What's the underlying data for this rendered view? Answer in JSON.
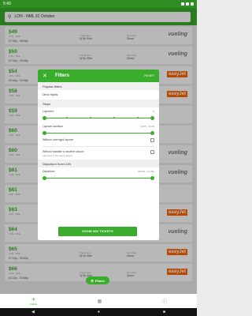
{
  "status": {
    "time": "5:49"
  },
  "search": {
    "route": "LON - NML 31 October"
  },
  "flights": [
    {
      "price": "$49",
      "route": "LON - NML",
      "times": "07:05p - 08:55p",
      "duration_label": "Travel time",
      "duration": "0(?)h 50m",
      "stops_label": "Non-stop",
      "stops": "Direct",
      "airline": "vueling"
    },
    {
      "price": "$50",
      "route": "LON - NML",
      "times": "07:20p - 09:45p",
      "duration_label": "Travel time",
      "duration": "0(?)h 25m",
      "stops_label": "Non-stop",
      "stops": "Direct",
      "airline": "vueling"
    },
    {
      "price": "$54",
      "route": "LON - NML",
      "times": "02:40p - 04:35p",
      "duration_label": "Travel time",
      "duration": "0(?)h 55m",
      "stops_label": "Non-stop",
      "stops": "Direct",
      "airline": "easyJet"
    },
    {
      "price": "$58",
      "route": "LON - NML",
      "times": "",
      "duration_label": "",
      "duration": "",
      "stops_label": "",
      "stops": "",
      "airline": "easyJet"
    },
    {
      "price": "$59",
      "route": "LON - NML",
      "times": "",
      "duration_label": "",
      "duration": "",
      "stops_label": "",
      "stops": "",
      "airline": ""
    },
    {
      "price": "$60",
      "route": "LON - NML",
      "times": "",
      "duration_label": "",
      "duration": "",
      "stops_label": "",
      "stops": "",
      "airline": ""
    },
    {
      "price": "$60",
      "route": "LON - NML",
      "times": "",
      "duration_label": "",
      "duration": "",
      "stops_label": "",
      "stops": "",
      "airline": "vueling"
    },
    {
      "price": "$61",
      "route": "LON - NML",
      "times": "",
      "duration_label": "",
      "duration": "",
      "stops_label": "",
      "stops": "",
      "airline": "vueling"
    },
    {
      "price": "$61",
      "route": "LON - NML",
      "times": "",
      "duration_label": "",
      "duration": "",
      "stops_label": "",
      "stops": "",
      "airline": ""
    },
    {
      "price": "$63",
      "route": "LON - NML",
      "times": "",
      "duration_label": "",
      "duration": "",
      "stops_label": "",
      "stops": "",
      "airline": "easyJet"
    },
    {
      "price": "$64",
      "route": "LON - NML",
      "times": "",
      "duration_label": "",
      "duration": "",
      "stops_label": "",
      "stops": "",
      "airline": "vueling"
    },
    {
      "price": "$65",
      "route": "LON - NML",
      "times": "07:15p - 09:00p",
      "duration_label": "Travel time",
      "duration": "0(?)h 45m",
      "stops_label": "Non-stop",
      "stops": "Direct",
      "airline": "easyJet"
    },
    {
      "price": "$66",
      "route": "LON - NML",
      "times": "03:15p - 04:55p",
      "duration_label": "Travel time",
      "duration": "0(?)h 40m",
      "stops_label": "Non-stop",
      "stops": "Direct",
      "airline": "easyJet"
    }
  ],
  "filters": {
    "title": "Filters",
    "reset": "RESET",
    "popular_section": "Popular filters",
    "direct_flights": "Direct flights",
    "stops_section": "Stops",
    "layovers": "Layovers",
    "layovers_value": "0",
    "layover_duration": "Layover duration",
    "layover_duration_value": "00:55 - 25:15",
    "without_overnight": "Without overnight layover",
    "without_transfer": "Without transfer to another airport",
    "without_transfer_sub": "Layovers in the same airport",
    "departure_section": "Departure from LON",
    "departure": "Departure",
    "departure_value": "05:00a - 11:45p",
    "show_button": "SHOW 683 TICKETS"
  },
  "fab": {
    "label": "Filters"
  },
  "nav": {
    "flights": "Flights",
    "icons": [
      "plane-icon",
      "bed-icon",
      "info-icon"
    ]
  },
  "colors": {
    "primary": "#3bad2c",
    "status": "#2f8d23",
    "easyjet": "#ff6600"
  }
}
